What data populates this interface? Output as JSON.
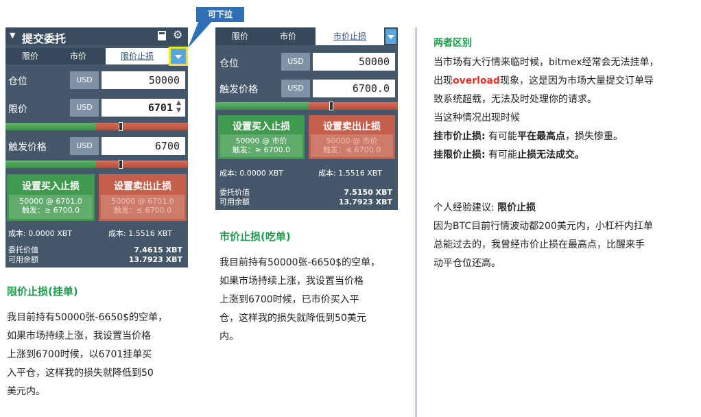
{
  "callout": {
    "label": "可下拉"
  },
  "panel1": {
    "title": "提交委托",
    "tabs": [
      "限价",
      "市价",
      "限价止损"
    ],
    "qty_label": "仓位",
    "qty_unit": "USD",
    "qty_value": "50000",
    "limit_label": "限价",
    "limit_unit": "USD",
    "limit_value": "6701",
    "trigger_label": "触发价格",
    "trigger_unit": "USD",
    "trigger_value": "6700",
    "buy_title": "设置买入止损",
    "buy_line1": "50000 @ 6701.0",
    "buy_line2": "触发：≥ 6700.0",
    "sell_title": "设置卖出止损",
    "sell_line1": "50000 @ 6701.0",
    "sell_line2": "触发：≤ 6700.0",
    "cost_buy": "成本: 0.0000 XBT",
    "cost_sell": "成本: 1.5516 XBT",
    "order_value_label": "委托价值",
    "order_value": "7.4615 XBT",
    "available_label": "可用余额",
    "available": "13.7923 XBT"
  },
  "panel2": {
    "tabs": [
      "限价",
      "市价",
      "市价止损"
    ],
    "qty_label": "仓位",
    "qty_unit": "USD",
    "qty_value": "50000",
    "trigger_label": "触发价格",
    "trigger_unit": "USD",
    "trigger_value": "6700.0",
    "buy_title": "设置买入止损",
    "buy_line1": "50000 @ 市价",
    "buy_line2": "触发：≥ 6700.0",
    "sell_title": "设置卖出止损",
    "sell_line1": "50000 @ 市价",
    "sell_line2": "触发：≤ 6700.0",
    "cost_buy": "成本: 0.0000 XBT",
    "cost_sell": "成本: 1.5516 XBT",
    "order_value_label": "委托价值",
    "order_value": "7.5150 XBT",
    "available_label": "可用余额",
    "available": "13.7923 XBT"
  },
  "left_text": {
    "heading": "限价止损(挂单)",
    "lines": [
      "我目前持有50000张-6650$的空单，",
      "如果市场持续上涨，我设置当价格",
      "上涨到6700时候，以6701挂单买",
      "入平仓，这样我的损失就降低到50",
      "美元内。"
    ]
  },
  "mid_text": {
    "heading": "市价止损(吃单)",
    "lines": [
      "我目前持有50000张-6650$的空单，",
      "如果市场持续上涨，我设置当价格",
      "上涨到6700时候，已市价买入平",
      "仓，这样我的损失就降低到50美元",
      "内。"
    ]
  },
  "right_text": {
    "heading": "两者区别",
    "l1": "当市场有大行情来临时候，bitmex经常会无法挂单，",
    "l2a": "出现",
    "l2b": "overload",
    "l2c": "现象，这是因为市场大量提交订单导",
    "l3": "致系统超载，无法及时处理你的请求。",
    "l4": "当这种情况出现时候",
    "l5a": "挂市价止损:",
    "l5b": " 有可能",
    "l5c": "平在最高点",
    "l5d": "，损失惨重。",
    "l6a": "挂限价止损:",
    "l6b": " 有可能",
    "l6c": "止损无法成交。",
    "l7a": "个人经验建议: ",
    "l7b": "限价止损",
    "l8": "因为BTC目前行情波动都200美元内，小杠杆内扛单",
    "l9": "总能过去的，我曾经市价止损在最高点，比醒来手",
    "l10": "动平仓位还高。"
  }
}
